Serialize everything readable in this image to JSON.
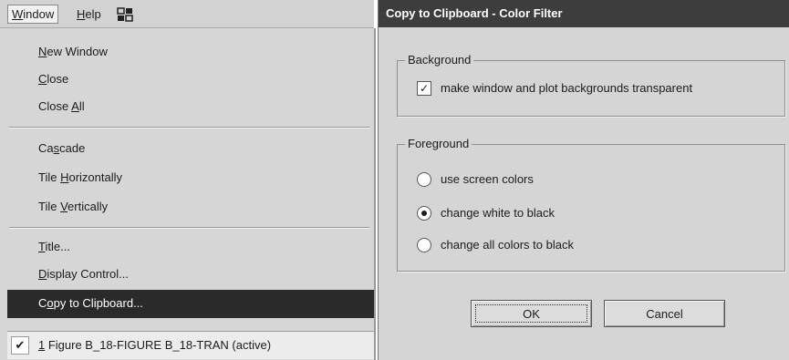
{
  "menubar": {
    "items": [
      {
        "label": "Window",
        "mnemonic": "W"
      },
      {
        "label": "Help",
        "mnemonic": "H"
      }
    ],
    "icon": "window-tile-icon"
  },
  "window_menu": {
    "items": [
      {
        "pre": "",
        "key": "N",
        "post": "ew Window"
      },
      {
        "pre": "",
        "key": "C",
        "post": "lose"
      },
      {
        "pre": "Close ",
        "key": "A",
        "post": "ll"
      },
      {
        "pre": "Ca",
        "key": "s",
        "post": "cade"
      },
      {
        "pre": "Tile ",
        "key": "H",
        "post": "orizontally"
      },
      {
        "pre": "Tile ",
        "key": "V",
        "post": "ertically"
      },
      {
        "pre": "",
        "key": "T",
        "post": "itle..."
      },
      {
        "pre": "",
        "key": "D",
        "post": "isplay Control..."
      },
      {
        "pre": "C",
        "key": "o",
        "post": "py to Clipboard..."
      }
    ],
    "active_window": {
      "key": "1",
      "label": " Figure B_18-FIGURE B_18-TRAN (active)",
      "checked": true
    }
  },
  "dialog": {
    "title": "Copy to Clipboard - Color Filter",
    "background_group": {
      "legend": "Background",
      "checkbox_label": "make window and plot backgrounds transparent",
      "checked": true
    },
    "foreground_group": {
      "legend": "Foreground",
      "options": [
        {
          "label": "use screen colors",
          "selected": false
        },
        {
          "label": "change white to black",
          "selected": true
        },
        {
          "label": "change all colors to black",
          "selected": false
        }
      ]
    },
    "ok_label": "OK",
    "cancel_label": "Cancel"
  }
}
